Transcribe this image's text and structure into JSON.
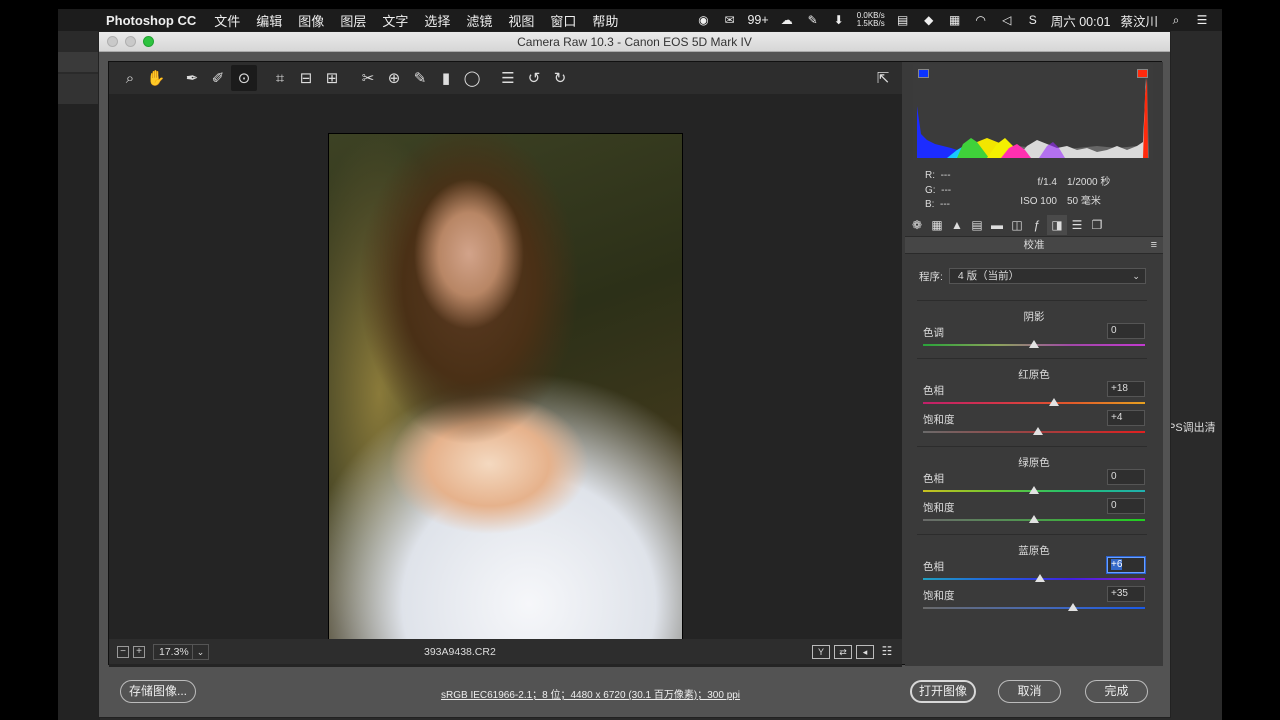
{
  "menubar": {
    "apple": "",
    "app_name": "Photoshop CC",
    "items": [
      "文件",
      "编辑",
      "图像",
      "图层",
      "文字",
      "选择",
      "滤镜",
      "视图",
      "窗口",
      "帮助"
    ],
    "badge": "99+",
    "net_up": "0.0KB/s",
    "net_down": "1.5KB/s",
    "clock": "周六 00:01",
    "user": "蔡汶川"
  },
  "background": {
    "side_text": "PS调出清"
  },
  "window": {
    "title": "Camera Raw 10.3 -  Canon EOS 5D Mark IV"
  },
  "toolbar": {
    "tools": [
      "zoom-icon",
      "hand-icon",
      "white-balance-icon",
      "color-sampler-icon",
      "targeted-adjustment-icon",
      "crop-icon",
      "straighten-icon",
      "transform-icon",
      "spot-removal-icon",
      "red-eye-icon",
      "adjustment-brush-icon",
      "graduated-filter-icon",
      "radial-filter-icon",
      "preferences-icon",
      "rotate-left-icon",
      "rotate-right-icon"
    ],
    "toggle_fullscreen": "fullscreen-toggle-icon"
  },
  "statusbar": {
    "zoom": "17.3%",
    "filename": "393A9438.CR2"
  },
  "histogram": {
    "r": "R:",
    "g": "G:",
    "b": "B:",
    "r_val": "---",
    "g_val": "---",
    "b_val": "---",
    "aperture": "f/1.4",
    "shutter": "1/2000 秒",
    "iso": "ISO 100",
    "focal": "50 毫米"
  },
  "panel": {
    "title": "校准",
    "process_label": "程序:",
    "process_value": "4 版（当前）",
    "shadows": {
      "title": "阴影",
      "tint_label": "色调",
      "tint_value": "0"
    },
    "red": {
      "title": "红原色",
      "hue_label": "色相",
      "hue_value": "+18",
      "sat_label": "饱和度",
      "sat_value": "+4"
    },
    "green": {
      "title": "绿原色",
      "hue_label": "色相",
      "hue_value": "0",
      "sat_label": "饱和度",
      "sat_value": "0"
    },
    "blue": {
      "title": "蓝原色",
      "hue_label": "色相",
      "hue_value": "+6",
      "sat_label": "饱和度",
      "sat_value": "+35"
    }
  },
  "footer": {
    "save_label": "存储图像...",
    "image_info": "sRGB IEC61966-2.1；8 位；4480 x 6720 (30.1 百万像素)；300 ppi",
    "open_label": "打开图像",
    "cancel_label": "取消",
    "done_label": "完成"
  }
}
